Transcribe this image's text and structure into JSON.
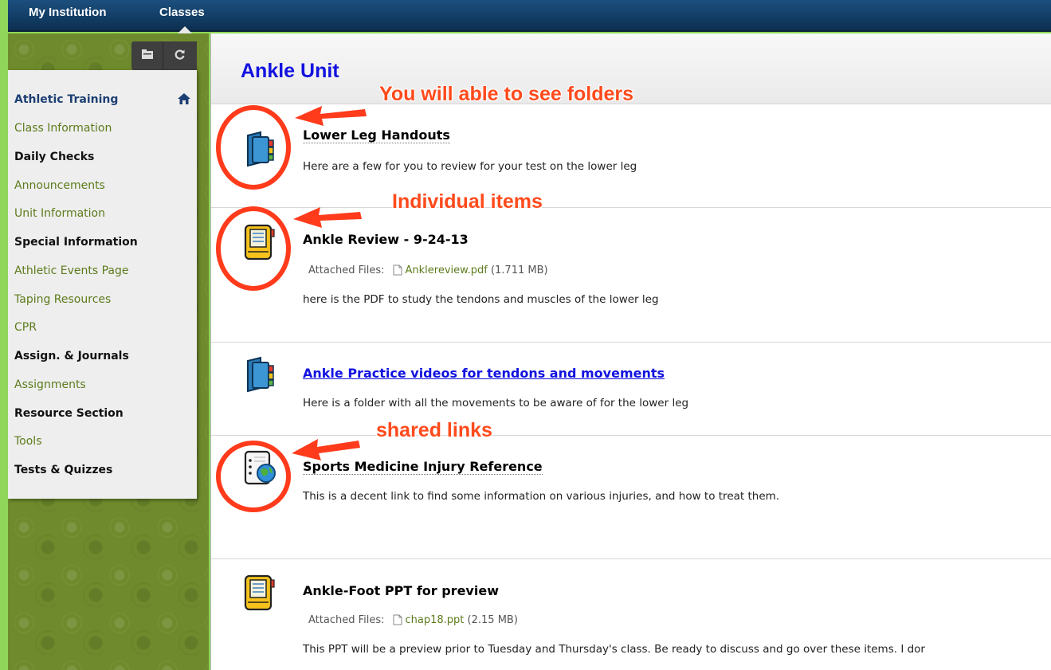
{
  "topnav": {
    "tab_my_institution": "My Institution",
    "tab_classes": "Classes"
  },
  "course_menu": {
    "title": "Athletic Training",
    "items": [
      {
        "label": "Class Information",
        "kind": "link"
      },
      {
        "label": "Daily Checks",
        "kind": "heading"
      },
      {
        "label": "Announcements",
        "kind": "link"
      },
      {
        "label": "Unit Information",
        "kind": "link"
      },
      {
        "label": "Special Information",
        "kind": "heading"
      },
      {
        "label": "Athletic Events Page",
        "kind": "link"
      },
      {
        "label": "Taping Resources",
        "kind": "link"
      },
      {
        "label": "CPR",
        "kind": "link"
      },
      {
        "label": "Assign. & Journals",
        "kind": "heading"
      },
      {
        "label": "Assignments",
        "kind": "link"
      },
      {
        "label": "Resource Section",
        "kind": "heading"
      },
      {
        "label": "Tools",
        "kind": "link"
      },
      {
        "label": "Tests & Quizzes",
        "kind": "heading"
      }
    ],
    "toolbar_icons": [
      "folder-view-icon",
      "refresh-icon"
    ],
    "home_icon": "home-icon"
  },
  "page": {
    "title": "Ankle Unit"
  },
  "entries": [
    {
      "icon": "folder-icon",
      "title": "Lower Leg Handouts",
      "description": "Here are a few for you to review for your test on the lower leg"
    },
    {
      "icon": "item-icon",
      "title": "Ankle Review - 9-24-13",
      "attached_label": "Attached Files:",
      "file_name": "Anklereview.pdf",
      "file_size": "(1.711 MB)",
      "description": "here is the PDF to study the tendons and muscles of the lower leg"
    },
    {
      "icon": "folder-icon",
      "title": "Ankle Practice videos for tendons and movements",
      "description": "Here is a folder with all the movements to be aware of for the lower leg"
    },
    {
      "icon": "web-link-icon",
      "title": "Sports Medicine Injury Reference",
      "description": "This is a decent link to find some information on various injuries, and how to treat them."
    },
    {
      "icon": "item-icon",
      "title": "Ankle-Foot PPT for preview",
      "attached_label": "Attached Files:",
      "file_name": "chap18.ppt",
      "file_size": "(2.15 MB)",
      "description": "This PPT will be a preview prior to Tuesday and Thursday's class.  Be ready to discuss and go over these items.  I dor"
    }
  ],
  "annotations": {
    "folders": "You will able to see folders",
    "items": "Individual items",
    "links": "shared links"
  },
  "colors": {
    "frame_green": "#8fd65a",
    "nav_blue": "#123c64",
    "menu_link_green": "#5d7b1c",
    "title_blue": "#1212e0",
    "annotation_red": "#ff4a1c"
  }
}
